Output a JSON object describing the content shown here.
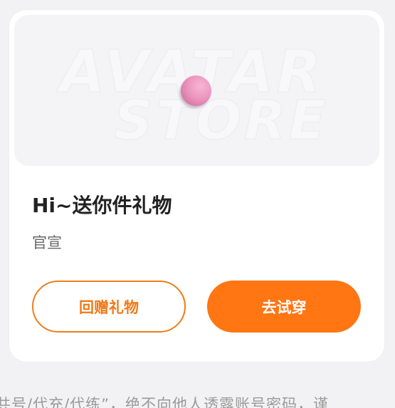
{
  "banner": {
    "watermark_line1": "AVATAR",
    "watermark_line2": "STORE"
  },
  "gift": {
    "title": "Hi~送你件礼物",
    "sender": "官宣"
  },
  "actions": {
    "return_gift_label": "回赠礼物",
    "try_on_label": "去试穿"
  },
  "footer": {
    "notice": "共号/代充/代练”，绝不向他人透露账号密码，谨"
  },
  "colors": {
    "accent": "#ff7613",
    "outline": "#f07d1a"
  }
}
